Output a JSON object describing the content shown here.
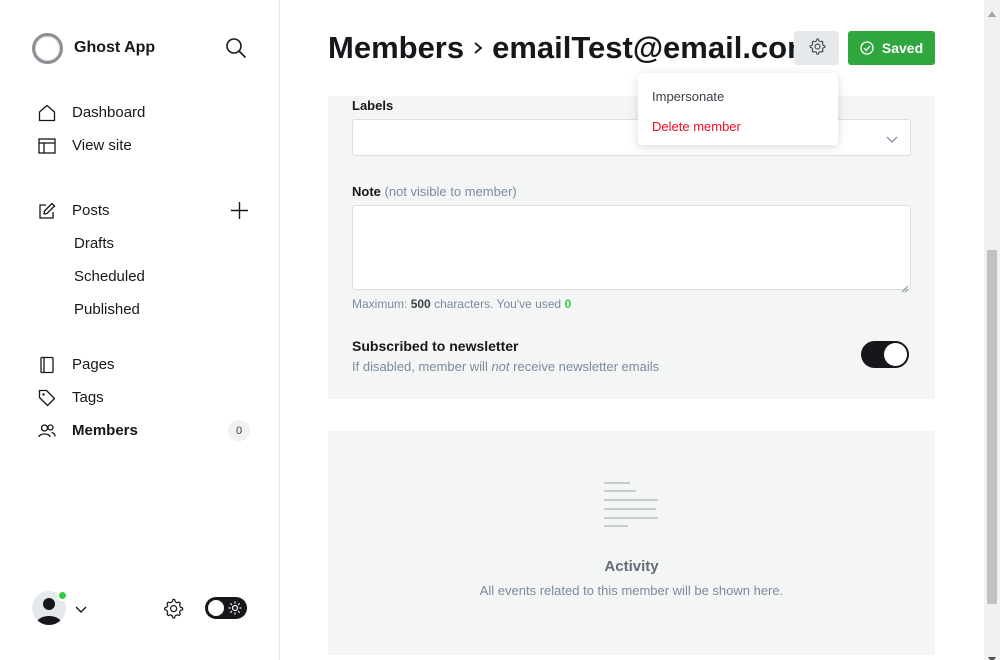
{
  "sidebar": {
    "brand_name": "Ghost App",
    "nav": {
      "dashboard": "Dashboard",
      "view_site": "View site",
      "posts": "Posts",
      "drafts": "Drafts",
      "scheduled": "Scheduled",
      "published": "Published",
      "pages": "Pages",
      "tags": "Tags",
      "members": "Members",
      "members_count": "0"
    }
  },
  "header": {
    "breadcrumb_parent": "Members",
    "member_email": "emailTest@email.com",
    "saved_label": "Saved"
  },
  "settings_menu": {
    "impersonate": "Impersonate",
    "delete_member": "Delete member"
  },
  "form": {
    "labels_label": "Labels",
    "note_label": "Note",
    "note_hint": "(not visible to member)",
    "char_prefix": "Maximum:",
    "char_max": "500",
    "char_middle": "characters. You've used",
    "char_used": "0",
    "newsletter_title": "Subscribed to newsletter",
    "newsletter_desc_before": "If disabled, member will",
    "newsletter_desc_em": "not",
    "newsletter_desc_after": "receive newsletter emails",
    "newsletter_subscribed": true
  },
  "activity": {
    "title": "Activity",
    "description": "All events related to this member will be shown here."
  },
  "colors": {
    "saved_green": "#30a63f",
    "delete_red": "#f50b23",
    "online_green": "#30cf43"
  },
  "icons": [
    "search-icon",
    "home-icon",
    "layout-icon",
    "edit-icon",
    "plus-icon",
    "page-icon",
    "tag-icon",
    "members-icon",
    "chevron-down-icon",
    "gear-icon",
    "sun-icon",
    "check-circle-icon",
    "chevron-right-icon",
    "activity-lines-icon"
  ]
}
